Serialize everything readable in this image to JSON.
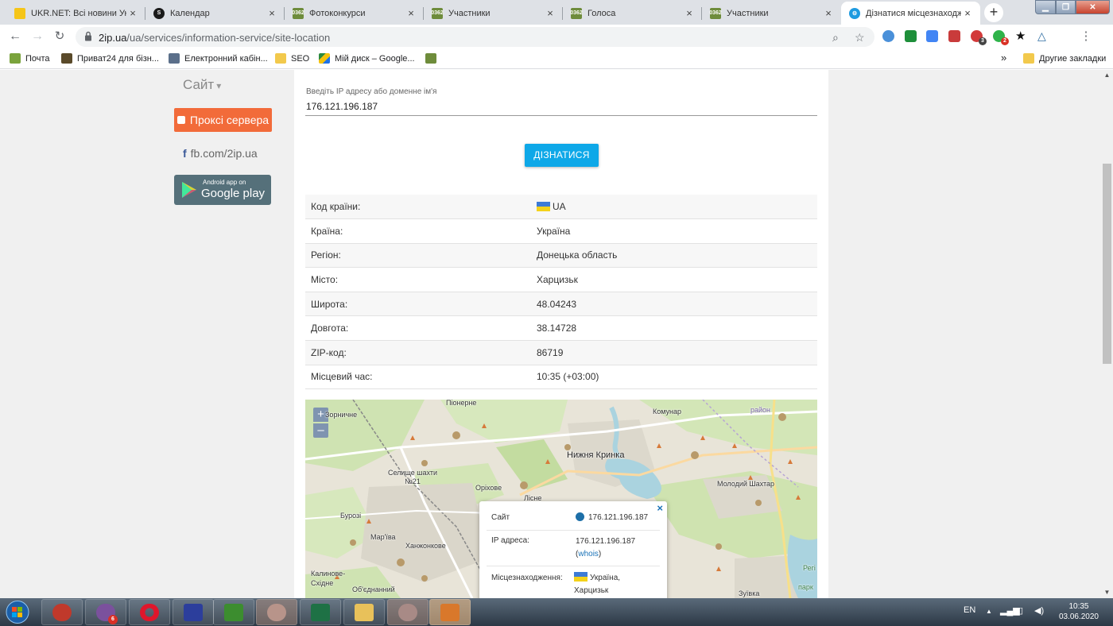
{
  "browser": {
    "tabs": [
      {
        "title": "UKR.NET: Всі новини Укр",
        "favicon": "ukrnet-icon",
        "color": "#f5c518"
      },
      {
        "title": "Календар",
        "favicon": "calendar-s-icon",
        "color": "#1a1a1a"
      },
      {
        "title": "Фотоконкурси",
        "favicon": "site-0362-icon",
        "color": "#6e8c3b"
      },
      {
        "title": "Участники",
        "favicon": "site-0362-icon",
        "color": "#6e8c3b"
      },
      {
        "title": "Голоса",
        "favicon": "site-0362-icon",
        "color": "#6e8c3b"
      },
      {
        "title": "Участники",
        "favicon": "site-0362-icon",
        "color": "#6e8c3b"
      },
      {
        "title": "Дізнатися місцезнаходж",
        "favicon": "2ip-icon",
        "color": "#1e9be0",
        "active": true
      }
    ],
    "favicon_text": "0362",
    "new_tab": "+",
    "url_host": "2ip.ua",
    "url_path": "/ua/services/information-service/site-location",
    "bookmarks": [
      {
        "label": "Почта",
        "icon": "mail-icon",
        "color": "#7aa33c"
      },
      {
        "label": "Приват24 для бізн...",
        "icon": "privat24-icon",
        "color": "#5a4a2a"
      },
      {
        "label": "Електронний кабін...",
        "icon": "document-icon",
        "color": "#5b6f8a"
      },
      {
        "label": "SEO",
        "icon": "folder-icon",
        "color": "#f2c94c"
      },
      {
        "label": "Мій диск – Google...",
        "icon": "google-drive-icon",
        "color": "#2b8a3e"
      }
    ],
    "bookmarks_overflow": "»",
    "other_bookmarks": "Другие закладки",
    "extension_badges": [
      "3",
      "2"
    ]
  },
  "sidebar": {
    "site_toggle": "Сайт",
    "proxy_button": "Проксі сервера",
    "fb_link": "fb.com/2ip.ua",
    "android_small": "Android app on",
    "android_big": "Google play"
  },
  "form": {
    "label": "Введіть IP адресу або доменне ім'я",
    "value": "176.121.196.187",
    "button": "ДІЗНАТИСЯ"
  },
  "info_table": {
    "rows": [
      {
        "key": "Код країни:",
        "value": "UA",
        "flag": true
      },
      {
        "key": "Країна:",
        "value": "Україна"
      },
      {
        "key": "Регіон:",
        "value": "Донецька область"
      },
      {
        "key": "Місто:",
        "value": "Харцизьк"
      },
      {
        "key": "Широта:",
        "value": "48.04243"
      },
      {
        "key": "Довгота:",
        "value": "38.14728"
      },
      {
        "key": "ZIP-код:",
        "value": "86719"
      },
      {
        "key": "Місцевий час:",
        "value": "10:35 (+03:00)"
      }
    ]
  },
  "map": {
    "zoom_in": "+",
    "zoom_out": "–",
    "places": [
      "Піонерне",
      "Зорничне",
      "Комунар",
      "Нижня Кринка",
      "Селище шахти №21",
      "Оріхове",
      "Лісне",
      "Молодий Шахтар",
      "Бурозі",
      "Мар'їва",
      "Ханжонкове",
      "Калинове-Східне",
      "Об'єднанний",
      "Зуївка",
      "район",
      "Регі",
      "парк"
    ],
    "popup": {
      "close": "×",
      "site_label": "Сайт",
      "site_value": "176.121.196.187",
      "ip_label": "IP адреса:",
      "ip_value": "176.121.196.187",
      "whois": "whois",
      "location_label": "Місцезнаходження:",
      "location_country": "Україна,",
      "location_city": "Харцизьк"
    }
  },
  "taskbar": {
    "viber_badge": "6",
    "lang": "EN",
    "time": "10:35",
    "date": "03.06.2020"
  }
}
